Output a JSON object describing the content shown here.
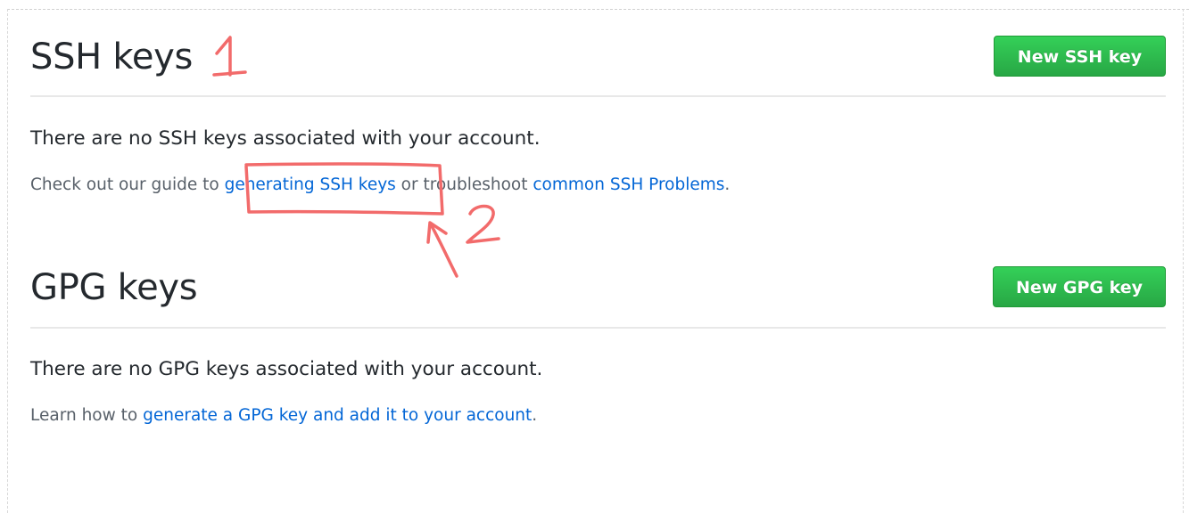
{
  "ssh": {
    "title": "SSH keys",
    "new_button": "New SSH key",
    "empty_message": "There are no SSH keys associated with your account.",
    "help_prefix": "Check out our guide to ",
    "help_link1": "generating SSH keys",
    "help_middle": " or troubleshoot ",
    "help_link2": "common SSH Problems",
    "help_suffix": "."
  },
  "gpg": {
    "title": "GPG keys",
    "new_button": "New GPG key",
    "empty_message": "There are no GPG keys associated with your account.",
    "help_prefix": "Learn how to ",
    "help_link": "generate a GPG key and add it to your account",
    "help_suffix": "."
  },
  "annotations": {
    "marker_1": "1",
    "marker_2": "2",
    "color": "#f26b6b"
  },
  "colors": {
    "button_green": "#28a745",
    "link_blue": "#0366d6",
    "heading": "#24292e",
    "muted": "#586069"
  }
}
